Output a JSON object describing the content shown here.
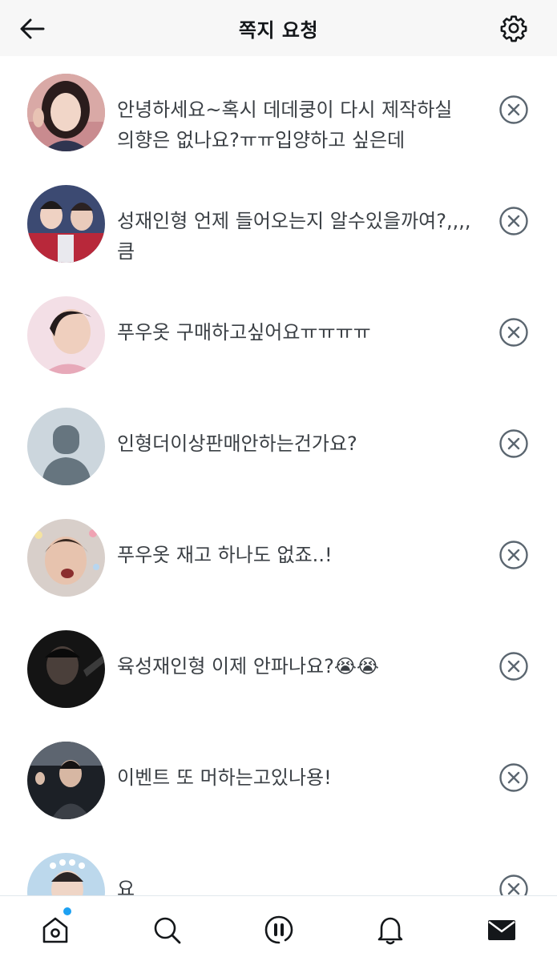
{
  "header": {
    "title": "쪽지 요청",
    "back_icon": "arrow-left-icon",
    "settings_icon": "gear-icon"
  },
  "requests": [
    {
      "avatar": "profile-photo",
      "text": "안녕하세요~혹시 데데쿵이 다시 제작하실 의향은 없나요?ㅠㅠ입양하고 싶은데"
    },
    {
      "avatar": "profile-photo",
      "text": "성재인형 언제 들어오는지 알수있을까여?,,,,큼"
    },
    {
      "avatar": "profile-photo",
      "text": "푸우옷 구매하고싶어요ㅠㅠㅠㅠ"
    },
    {
      "avatar": "default-avatar",
      "text": "인형더이상판매안하는건가요?"
    },
    {
      "avatar": "profile-photo",
      "text": "푸우옷 재고 하나도 없죠..!"
    },
    {
      "avatar": "profile-photo",
      "text": "육성재인형 이제 안파나요?😭😭"
    },
    {
      "avatar": "profile-photo",
      "text": "이벤트 또 머하는고있나용!"
    },
    {
      "avatar": "profile-photo",
      "text": "요"
    }
  ],
  "dismiss_icon": "close-circle-icon",
  "tabbar": {
    "items": [
      "home-icon",
      "search-icon",
      "spaces-icon",
      "bell-icon",
      "mail-icon"
    ],
    "active": "mail-icon",
    "accent": "#1da1f2"
  }
}
